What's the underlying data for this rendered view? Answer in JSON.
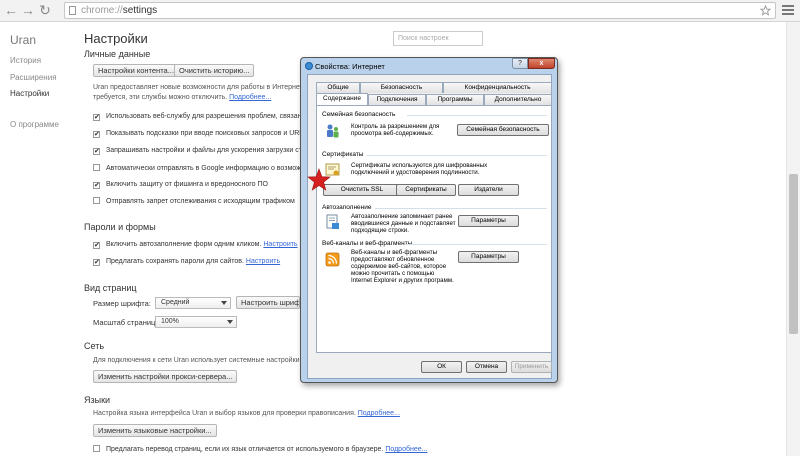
{
  "browser": {
    "url_scheme": "chrome://",
    "url_path": "settings"
  },
  "sidebar": {
    "title": "Uran",
    "items": [
      {
        "label": "История"
      },
      {
        "label": "Расширения"
      },
      {
        "label": "Настройки"
      },
      {
        "label": "О программе"
      }
    ]
  },
  "settings": {
    "title": "Настройки",
    "search_placeholder": "Поиск настроек",
    "personal": {
      "heading": "Личные данные",
      "btn_content": "Настройки контента...",
      "btn_clear": "Очистить историю...",
      "note1": "Uran предоставляет новые возможности для работы в Интернете в",
      "note2": "требуется, эти службы можно отключить.",
      "note_link": "Подробнее...",
      "options": [
        {
          "label": "Использовать веб-службу для разрешения проблем, связанн"
        },
        {
          "label": "Показывать подсказки при вводе поисковых запросов и URL"
        },
        {
          "label": "Запрашивать настройки и файлы для ускорения загрузки стран"
        },
        {
          "label": "Автоматически отправлять в Google информацию о возможн"
        },
        {
          "label": "Включить защиту от фишинга и вредоносного ПО"
        },
        {
          "label": "Отправлять запрет отслеживания с исходящим трафиком"
        }
      ]
    },
    "passwords": {
      "heading": "Пароли и формы",
      "autofill": "Включить автозаполнение форм одним кликом.",
      "autofill_link": "Настроить",
      "save": "Предлагать сохранять пароли для сайтов.",
      "save_link": "Настроить"
    },
    "view": {
      "heading": "Вид страниц",
      "font_label": "Размер шрифта:",
      "font_value": "Средний",
      "font_button": "Настроить шрифты",
      "zoom_label": "Масштаб страницы:",
      "zoom_value": "100%"
    },
    "network": {
      "heading": "Сеть",
      "note": "Для подключения к сети Uran использует системные настройки прок",
      "button": "Изменить настройки прокси-сервера..."
    },
    "languages": {
      "heading": "Языки",
      "note": "Настройка языка интерфейса Uran и выбор языков для проверки правописания.",
      "note_link": "Подробнее...",
      "button": "Изменить языковые настройки...",
      "translate": "Предлагать перевод страниц, если их язык отличается от используемого в браузере.",
      "translate_link": "Подробнее..."
    }
  },
  "dialog": {
    "title": "Свойства: Интернет",
    "help": "?",
    "close": "x",
    "tabs_top": [
      {
        "label": "Общие"
      },
      {
        "label": "Безопасность"
      },
      {
        "label": "Конфиденциальность"
      }
    ],
    "tabs_bottom": [
      {
        "label": "Содержание"
      },
      {
        "label": "Подключения"
      },
      {
        "label": "Программы"
      },
      {
        "label": "Дополнительно"
      }
    ],
    "family": {
      "heading": "Семейная безопасность",
      "text1": "Контроль за разрешением для",
      "text2": "просмотра веб-содержимых.",
      "button": "Семейная безопасность"
    },
    "certs": {
      "heading": "Сертификаты",
      "text1": "Сертификаты используются для шифрованных",
      "text2": "подключений и удостоверения подлинности.",
      "btn_ssl": "Очистить SSL",
      "btn_certs": "Сертификаты",
      "btn_publishers": "Издатели"
    },
    "autocomplete": {
      "heading": "Автозаполнение",
      "text1": "Автозаполнение запоминает ранее",
      "text2": "вводившиеся данные и подставляет",
      "text3": "подходящие строки.",
      "button": "Параметры"
    },
    "feeds": {
      "heading": "Веб-каналы и веб-фрагменты",
      "text1": "Веб-каналы и веб-фрагменты",
      "text2": "предоставляют обновленное",
      "text3": "содержимое веб-сайтов, которое",
      "text4": "можно прочитать с помощью",
      "text5": "Internet Explorer и других программ.",
      "button": "Параметры"
    },
    "footer": {
      "ok": "ОК",
      "cancel": "Отмена",
      "apply": "Применить"
    }
  },
  "colors": {
    "marker_star": "#d42020",
    "link": "#3367d6",
    "dialog_frame": "#b9d1ea"
  }
}
